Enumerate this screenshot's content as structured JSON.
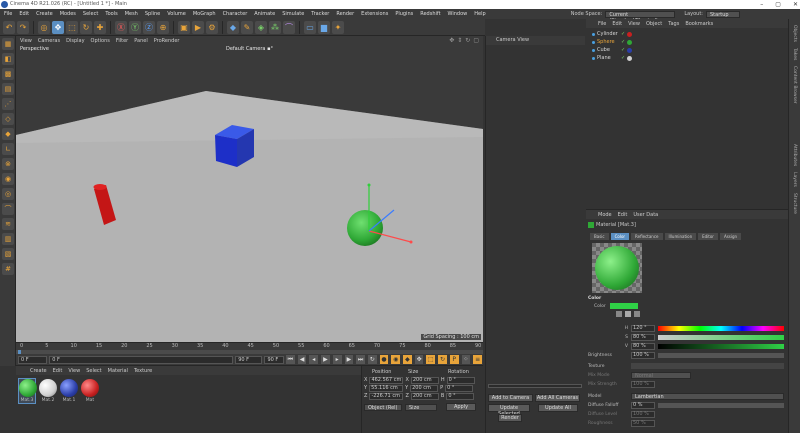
{
  "window": {
    "title": "Cinema 4D R21.026 (RC) - [Untitled 1 *] - Main",
    "controls": [
      "–",
      "▢",
      "✕"
    ]
  },
  "menubar": {
    "items": [
      "File",
      "Edit",
      "Create",
      "Modes",
      "Select",
      "Tools",
      "Mesh",
      "Spline",
      "Volume",
      "MoGraph",
      "Character",
      "Animate",
      "Simulate",
      "Tracker",
      "Render",
      "Extensions",
      "Plugins",
      "Redshift",
      "Window",
      "Help"
    ],
    "node_space_label": "Node Space:",
    "node_space_value": "Current (Standard/Physical)",
    "layout_label": "Layout:",
    "layout_value": "Startup"
  },
  "viewport": {
    "menu": [
      "View",
      "Cameras",
      "Display",
      "Options",
      "Filter",
      "Panel",
      "ProRender"
    ],
    "label": "Perspective",
    "camera": "Default Camera ▪°",
    "grid_info": "Grid Spacing : 100 cm"
  },
  "timeline": {
    "ticks": [
      "0",
      "5",
      "10",
      "15",
      "20",
      "25",
      "30",
      "35",
      "40",
      "45",
      "50",
      "55",
      "60",
      "65",
      "70",
      "75",
      "80",
      "85",
      "90"
    ],
    "start_field": "0 F",
    "current_field": "0 F",
    "end_field": "90 F",
    "end_field2": "90 F",
    "frame_readout": "0 F"
  },
  "material_manager": {
    "menu": [
      "Create",
      "Edit",
      "View",
      "Select",
      "Material",
      "Texture"
    ],
    "materials": [
      {
        "name": "Mat.3",
        "color": "#2fa836"
      },
      {
        "name": "Mat.2",
        "color": "#d0d0d0"
      },
      {
        "name": "Mat.1",
        "color": "#2b3ea8"
      },
      {
        "name": "Mat",
        "color": "#c82020"
      }
    ]
  },
  "coordinates": {
    "headers": [
      "Position",
      "Size",
      "Rotation"
    ],
    "rows": [
      {
        "axis": "X",
        "pos": "462.567 cm",
        "size_axis": "X",
        "size": "200 cm",
        "rot_axis": "H",
        "rot": "0 °"
      },
      {
        "axis": "Y",
        "pos": "55.116 cm",
        "size_axis": "Y",
        "size": "200 cm",
        "rot_axis": "P",
        "rot": "0 °"
      },
      {
        "axis": "Z",
        "pos": "-226.71 cm",
        "size_axis": "Z",
        "size": "200 cm",
        "rot_axis": "B",
        "rot": "0 °"
      }
    ],
    "mode_select": "Object (Rel)",
    "size_select": "Size",
    "apply_label": "Apply"
  },
  "camera_panel": {
    "title": "Camera View",
    "add_button": "Add to Camera",
    "add_all_button": "Add All Cameras",
    "update_selected": "Update Selected",
    "update_all": "Update All",
    "render_button": "Render"
  },
  "object_manager": {
    "menu": [
      "File",
      "Edit",
      "View",
      "Object",
      "Tags",
      "Bookmarks"
    ],
    "objects": [
      {
        "name": "Cylinder",
        "tag_color": "#c82020"
      },
      {
        "name": "Sphere",
        "tag_color": "#2fa836"
      },
      {
        "name": "Cube",
        "tag_color": "#2b3ea8"
      },
      {
        "name": "Plane",
        "tag_color": "#d0d0d0"
      }
    ]
  },
  "attribute_manager": {
    "menu": [
      "Mode",
      "Edit",
      "User Data"
    ],
    "material_title": "Material [Mat.3]",
    "tabs": [
      "Basic",
      "Color",
      "Reflectance",
      "Illumination",
      "Editor",
      "Assign"
    ],
    "active_tab": "Color",
    "section_color": "Color",
    "color_label": "Color",
    "h_label": "H",
    "h_value": "120 °",
    "s_label": "S",
    "s_value": "80 %",
    "v_label": "V",
    "v_value": "80 %",
    "brightness_label": "Brightness",
    "brightness_value": "100 %",
    "texture_label": "Texture",
    "mix_mode_label": "Mix Mode",
    "mix_mode_value": "Normal",
    "mix_strength_label": "Mix Strength",
    "mix_strength_value": "100 %",
    "model_label": "Model",
    "model_value": "Lambertian",
    "diffuse_falloff_label": "Diffuse Falloff",
    "diffuse_falloff_value": "0 %",
    "diffuse_level_label": "Diffuse Level",
    "diffuse_level_value": "100 %",
    "roughness_label": "Roughness",
    "roughness_value": "50 %",
    "swatch_color": "#2fd046"
  },
  "side_tabs": [
    "Objects",
    "Takes",
    "Content Browser",
    "Attributes",
    "Layers",
    "Structure"
  ]
}
